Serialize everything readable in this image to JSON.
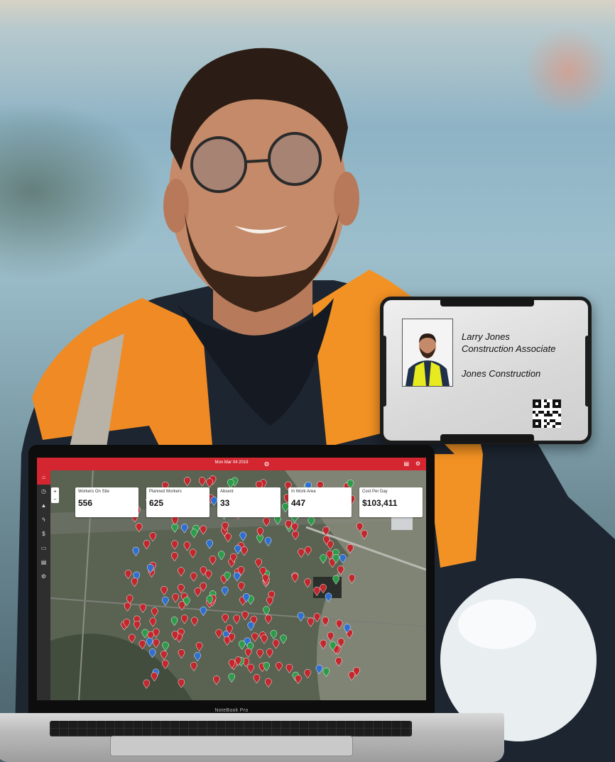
{
  "badge": {
    "name": "Larry Jones",
    "title": "Construction Associate",
    "company": "Jones Construction"
  },
  "laptop": {
    "brand": "NoteBook Pro"
  },
  "dashboard": {
    "date": "Mon Mar 04 2019",
    "header_icons": [
      "globe-icon",
      "clipboard-icon",
      "gear-icon"
    ],
    "nav_items": [
      {
        "icon": "home-icon",
        "active": true
      },
      {
        "icon": "clock-icon",
        "active": false
      },
      {
        "icon": "warning-icon",
        "active": false
      },
      {
        "icon": "lightning-icon",
        "active": false
      },
      {
        "icon": "dollar-icon",
        "active": false
      },
      {
        "icon": "chat-icon",
        "active": false
      },
      {
        "icon": "clipboard-icon",
        "active": false
      },
      {
        "icon": "gear-icon",
        "active": false
      }
    ],
    "kpis": [
      {
        "label": "Workers On Site",
        "value": "556"
      },
      {
        "label": "Planned Workers",
        "value": "625"
      },
      {
        "label": "Absent",
        "value": "33"
      },
      {
        "label": "In Work Area",
        "value": "447"
      },
      {
        "label": "Cost Per Day",
        "value": "$103,411"
      }
    ],
    "zoom": {
      "in": "+",
      "out": "−"
    },
    "colors": {
      "accent": "#d32630",
      "marker_red": "#c1272d",
      "marker_green": "#2e9b4a",
      "marker_blue": "#2f6fd0"
    }
  }
}
